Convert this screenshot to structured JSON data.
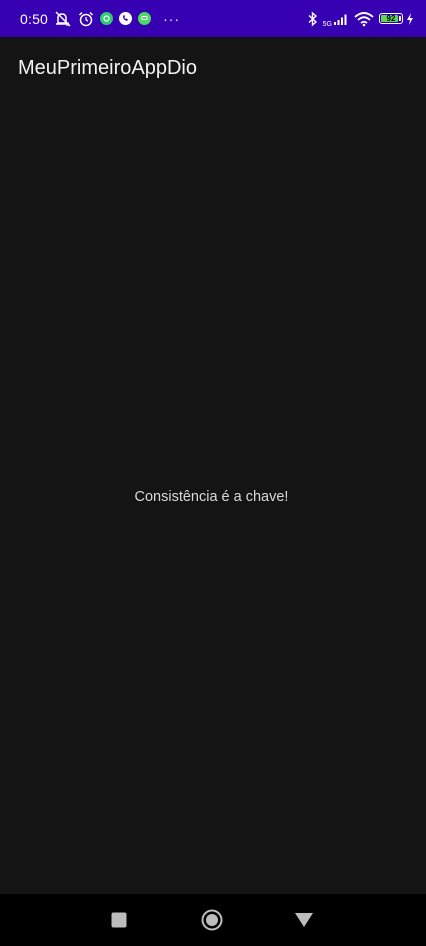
{
  "status_bar": {
    "time": "0:50",
    "background": "#3700b3",
    "battery_level": "92",
    "network": "5G",
    "left_icons": [
      "mute-icon",
      "alarm-icon",
      "app-notification-green-icon",
      "whatsapp-icon",
      "messenger-icon"
    ],
    "more": "···",
    "right_icons": [
      "bluetooth-icon",
      "signal-icon",
      "wifi-icon",
      "battery-icon",
      "charging-icon"
    ]
  },
  "app_bar": {
    "title": "MeuPrimeiroAppDio"
  },
  "main": {
    "message": "Consistência é a chave!"
  },
  "nav_bar": {
    "buttons": [
      "recents-square-icon",
      "home-circle-icon",
      "back-triangle-icon"
    ]
  },
  "colors": {
    "background": "#141414",
    "status_bar": "#3700b3",
    "title_text": "#f2f2f2",
    "body_text": "#d9d9d9",
    "nav_bar": "#000000",
    "battery_fill": "#5cd65c"
  }
}
